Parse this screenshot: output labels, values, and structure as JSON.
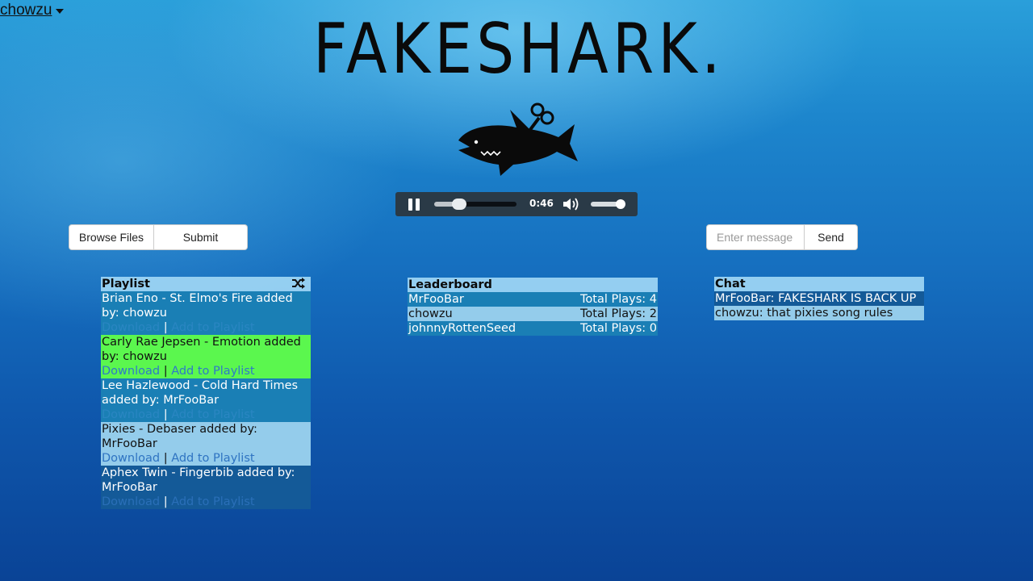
{
  "user": {
    "name": "chowzu"
  },
  "logo": {
    "text": "FAKESHARK."
  },
  "player": {
    "time": "0:46",
    "progress": 0.3,
    "volume": 0.9,
    "state": "playing"
  },
  "upload": {
    "browse_label": "Browse Files",
    "submit_label": "Submit"
  },
  "chat_form": {
    "placeholder": "Enter message",
    "send_label": "Send"
  },
  "playlist": {
    "title": "Playlist",
    "download_label": "Download",
    "add_label": "Add to Playlist",
    "separator": "|",
    "items": [
      {
        "text": "Brian Eno - St. Elmo's Fire added by: chowzu"
      },
      {
        "text": "Carly Rae Jepsen - Emotion added by: chowzu"
      },
      {
        "text": "Lee Hazlewood - Cold Hard Times added by: MrFooBar"
      },
      {
        "text": "Pixies - Debaser added by: MrFooBar"
      },
      {
        "text": "Aphex Twin - Fingerbib added by: MrFooBar"
      }
    ]
  },
  "leaderboard": {
    "title": "Leaderboard",
    "rows": [
      {
        "name": "MrFooBar",
        "plays": "Total Plays: 4"
      },
      {
        "name": "chowzu",
        "plays": "Total Plays: 2"
      },
      {
        "name": "johnnyRottenSeed",
        "plays": "Total Plays: 0"
      }
    ]
  },
  "chat": {
    "title": "Chat",
    "messages": [
      "MrFooBar: FAKESHARK IS BACK UP",
      "chowzu: that pixies song rules"
    ]
  },
  "colors": {
    "accent_green": "#5bf74e",
    "player_bg": "#2a3a47"
  }
}
